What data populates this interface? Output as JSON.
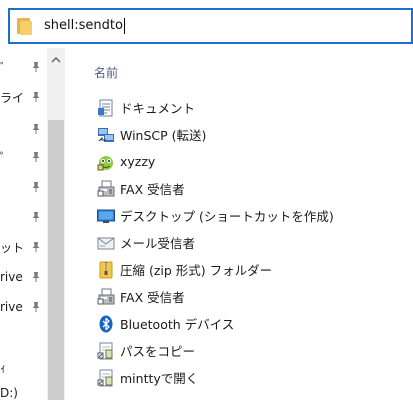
{
  "address_bar": {
    "value": "shell:sendto"
  },
  "nav_pane": {
    "items": [
      {
        "label": "ﾞ",
        "pinned": true
      },
      {
        "label": "ライ",
        "pinned": true
      },
      {
        "label": "",
        "pinned": true
      },
      {
        "label": "ﾟ",
        "pinned": true
      },
      {
        "label": "",
        "pinned": true
      },
      {
        "label": "",
        "pinned": true
      },
      {
        "label": "ット",
        "pinned": true
      },
      {
        "label": "rive",
        "pinned": true
      },
      {
        "label": "rive",
        "pinned": true
      },
      {
        "label": "",
        "pinned": false
      },
      {
        "label": "ｨ",
        "pinned": false
      },
      {
        "label": "D:)",
        "pinned": false
      }
    ]
  },
  "content": {
    "column_header": "名前",
    "items": [
      {
        "name": "ドキュメント",
        "icon": "document-icon"
      },
      {
        "name": "WinSCP (転送)",
        "icon": "winscp-icon"
      },
      {
        "name": "xyzzy",
        "icon": "xyzzy-icon"
      },
      {
        "name": "FAX 受信者",
        "icon": "fax-icon"
      },
      {
        "name": "デスクトップ (ショートカットを作成)",
        "icon": "desktop-icon"
      },
      {
        "name": "メール受信者",
        "icon": "mail-icon"
      },
      {
        "name": "圧縮 (zip 形式) フォルダー",
        "icon": "zip-folder-icon"
      },
      {
        "name": "FAX 受信者",
        "icon": "fax-icon"
      },
      {
        "name": "Bluetooth デバイス",
        "icon": "bluetooth-icon"
      },
      {
        "name": "パスをコピー",
        "icon": "shortcut-icon"
      },
      {
        "name": "minttyで開く",
        "icon": "shortcut-icon"
      }
    ]
  },
  "colors": {
    "accent": "#1e6fd0",
    "header_text": "#4d6082",
    "scroll_thumb": "#cdcdcd",
    "scroll_track": "#f0f0f0"
  }
}
